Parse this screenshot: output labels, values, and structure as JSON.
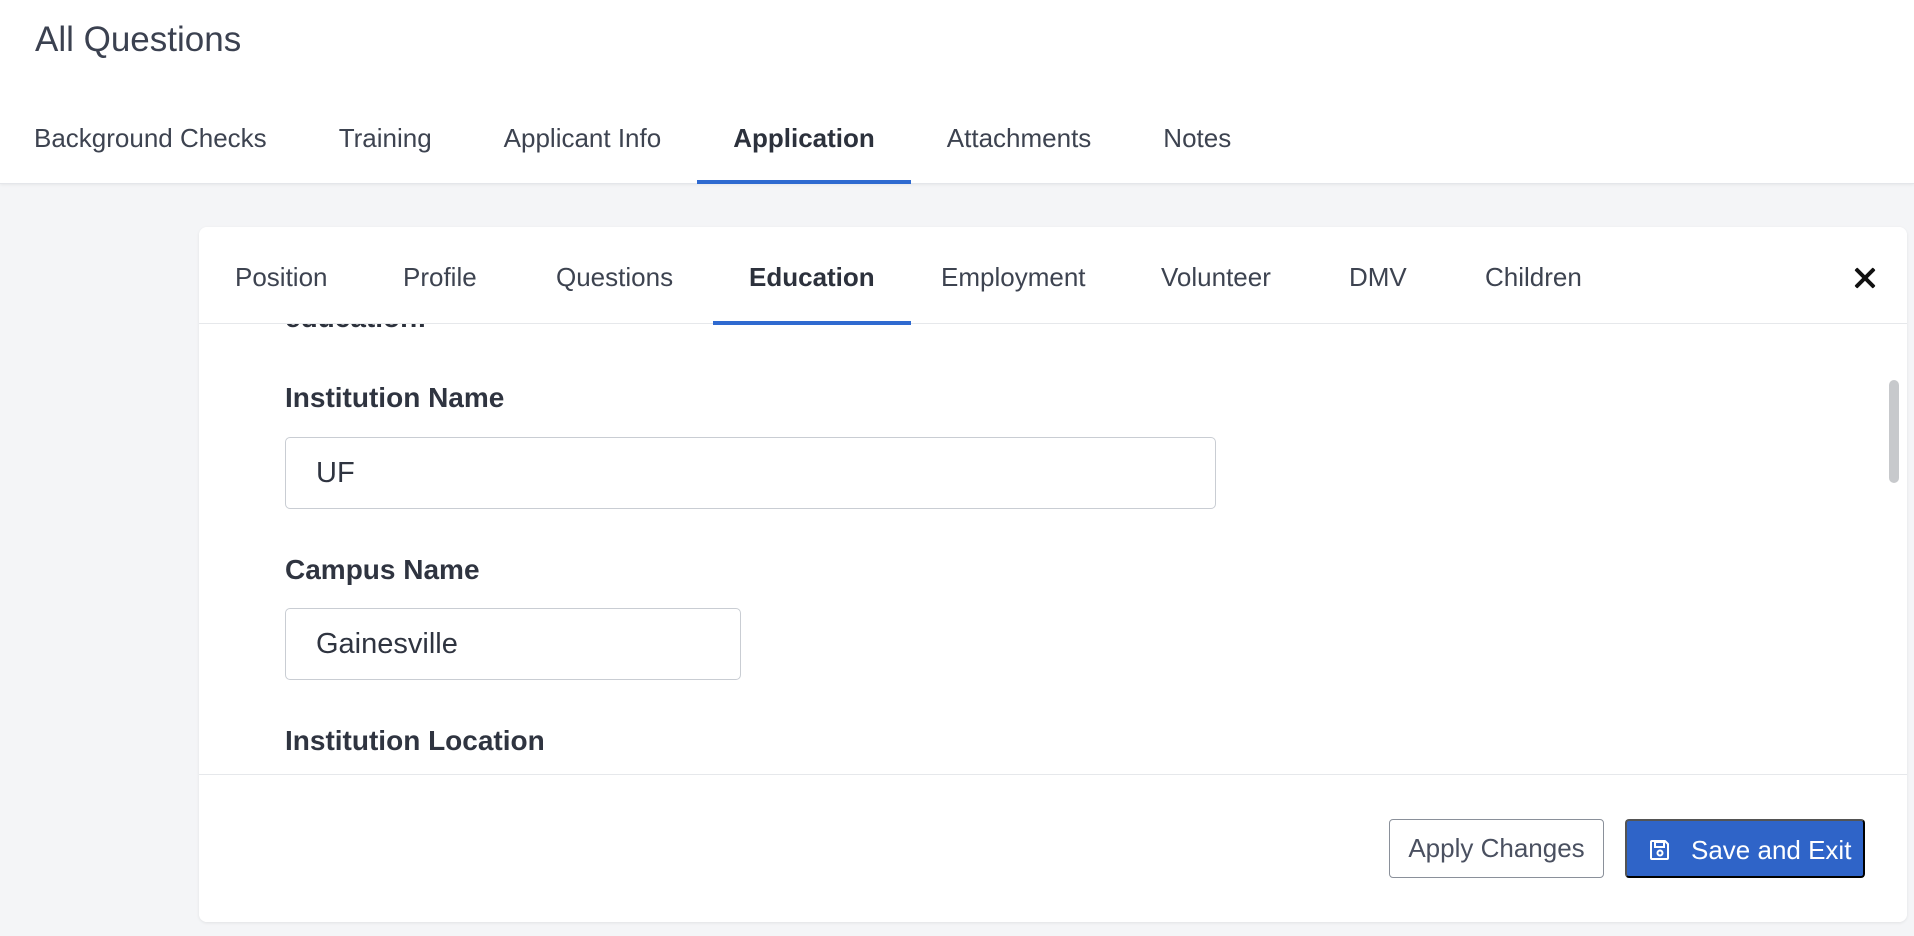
{
  "header": {
    "title": "All Questions",
    "tabs": [
      {
        "label": "Background Checks"
      },
      {
        "label": "Training"
      },
      {
        "label": "Applicant Info"
      },
      {
        "label": "Application"
      },
      {
        "label": "Attachments"
      },
      {
        "label": "Notes"
      }
    ],
    "active_tab": "Application"
  },
  "application": {
    "sub_tabs": [
      {
        "label": "Position"
      },
      {
        "label": "Profile"
      },
      {
        "label": "Questions"
      },
      {
        "label": "Education"
      },
      {
        "label": "Employment"
      },
      {
        "label": "Volunteer"
      },
      {
        "label": "DMV"
      },
      {
        "label": "Children"
      }
    ],
    "active_sub_tab": "Education",
    "close_icon": "close-icon",
    "education": {
      "cut_off_heading": "education:",
      "fields": [
        {
          "label": "Institution Name",
          "value": "UF"
        },
        {
          "label": "Campus Name",
          "value": "Gainesville"
        },
        {
          "label": "Institution Location"
        }
      ]
    }
  },
  "footer": {
    "apply_label": "Apply Changes",
    "save_label": "Save and Exit",
    "save_icon": "save-icon"
  },
  "colors": {
    "accent": "#2f6ad0",
    "button_primary": "#2f64c8",
    "background": "#f4f5f7"
  }
}
